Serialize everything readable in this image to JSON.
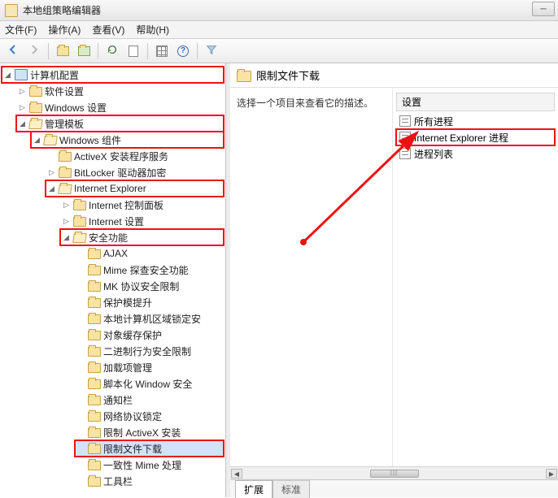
{
  "window": {
    "title": "本地组策略编辑器"
  },
  "menu": {
    "file": "文件(F)",
    "action": "操作(A)",
    "view": "查看(V)",
    "help": "帮助(H)"
  },
  "tree": {
    "root": "计算机配置",
    "software": "软件设置",
    "windows_settings": "Windows 设置",
    "admin_templates": "管理模板",
    "windows_components": "Windows 组件",
    "activex": "ActiveX 安装程序服务",
    "bitlocker": "BitLocker 驱动器加密",
    "ie": "Internet Explorer",
    "ie_cpl": "Internet 控制面板",
    "ie_settings": "Internet 设置",
    "security_features": "安全功能",
    "ajax": "AJAX",
    "mime_sniff": "Mime 探查安全功能",
    "mk_proto": "MK 协议安全限制",
    "protect_elev": "保护模提升",
    "local_zone_lock": "本地计算机区域锁定安",
    "object_cache": "对象缓存保护",
    "binary_behavior": "二进制行为安全限制",
    "addon_mgmt": "加载项管理",
    "scripted_window": "脚本化 Window 安全",
    "notification_bar": "通知栏",
    "network_proto_lock": "网络协议锁定",
    "restrict_activex": "限制 ActiveX 安装",
    "restrict_download": "限制文件下载",
    "consistent_mime": "一致性 Mime 处理",
    "toolbar": "工具栏"
  },
  "content": {
    "title": "限制文件下载",
    "description": "选择一个项目来查看它的描述。",
    "settings_header": "设置",
    "items": {
      "all_processes": "所有进程",
      "ie_processes": "Internet Explorer 进程",
      "process_list": "进程列表"
    }
  },
  "tabs": {
    "extended": "扩展",
    "standard": "标准"
  }
}
